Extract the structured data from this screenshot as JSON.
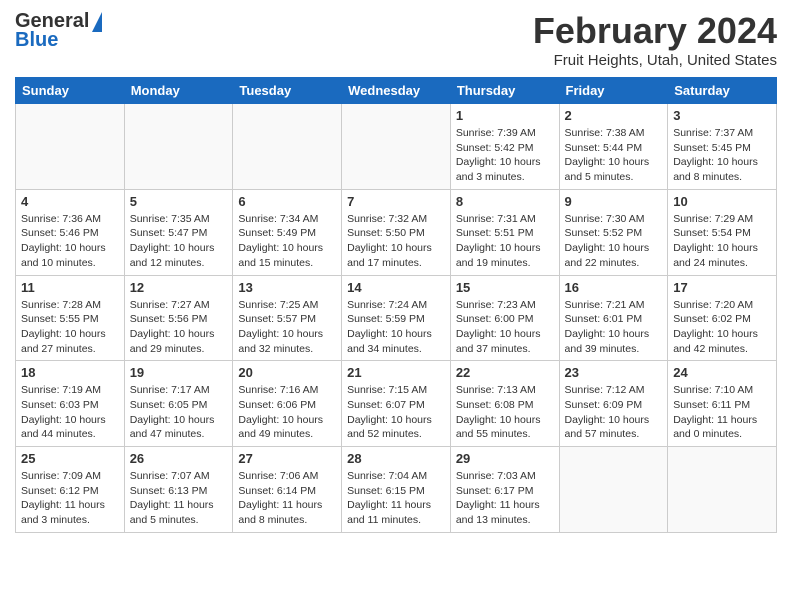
{
  "header": {
    "logo_general": "General",
    "logo_blue": "Blue",
    "month_year": "February 2024",
    "location": "Fruit Heights, Utah, United States"
  },
  "weekdays": [
    "Sunday",
    "Monday",
    "Tuesday",
    "Wednesday",
    "Thursday",
    "Friday",
    "Saturday"
  ],
  "weeks": [
    [
      {
        "day": "",
        "info": ""
      },
      {
        "day": "",
        "info": ""
      },
      {
        "day": "",
        "info": ""
      },
      {
        "day": "",
        "info": ""
      },
      {
        "day": "1",
        "info": "Sunrise: 7:39 AM\nSunset: 5:42 PM\nDaylight: 10 hours\nand 3 minutes."
      },
      {
        "day": "2",
        "info": "Sunrise: 7:38 AM\nSunset: 5:44 PM\nDaylight: 10 hours\nand 5 minutes."
      },
      {
        "day": "3",
        "info": "Sunrise: 7:37 AM\nSunset: 5:45 PM\nDaylight: 10 hours\nand 8 minutes."
      }
    ],
    [
      {
        "day": "4",
        "info": "Sunrise: 7:36 AM\nSunset: 5:46 PM\nDaylight: 10 hours\nand 10 minutes."
      },
      {
        "day": "5",
        "info": "Sunrise: 7:35 AM\nSunset: 5:47 PM\nDaylight: 10 hours\nand 12 minutes."
      },
      {
        "day": "6",
        "info": "Sunrise: 7:34 AM\nSunset: 5:49 PM\nDaylight: 10 hours\nand 15 minutes."
      },
      {
        "day": "7",
        "info": "Sunrise: 7:32 AM\nSunset: 5:50 PM\nDaylight: 10 hours\nand 17 minutes."
      },
      {
        "day": "8",
        "info": "Sunrise: 7:31 AM\nSunset: 5:51 PM\nDaylight: 10 hours\nand 19 minutes."
      },
      {
        "day": "9",
        "info": "Sunrise: 7:30 AM\nSunset: 5:52 PM\nDaylight: 10 hours\nand 22 minutes."
      },
      {
        "day": "10",
        "info": "Sunrise: 7:29 AM\nSunset: 5:54 PM\nDaylight: 10 hours\nand 24 minutes."
      }
    ],
    [
      {
        "day": "11",
        "info": "Sunrise: 7:28 AM\nSunset: 5:55 PM\nDaylight: 10 hours\nand 27 minutes."
      },
      {
        "day": "12",
        "info": "Sunrise: 7:27 AM\nSunset: 5:56 PM\nDaylight: 10 hours\nand 29 minutes."
      },
      {
        "day": "13",
        "info": "Sunrise: 7:25 AM\nSunset: 5:57 PM\nDaylight: 10 hours\nand 32 minutes."
      },
      {
        "day": "14",
        "info": "Sunrise: 7:24 AM\nSunset: 5:59 PM\nDaylight: 10 hours\nand 34 minutes."
      },
      {
        "day": "15",
        "info": "Sunrise: 7:23 AM\nSunset: 6:00 PM\nDaylight: 10 hours\nand 37 minutes."
      },
      {
        "day": "16",
        "info": "Sunrise: 7:21 AM\nSunset: 6:01 PM\nDaylight: 10 hours\nand 39 minutes."
      },
      {
        "day": "17",
        "info": "Sunrise: 7:20 AM\nSunset: 6:02 PM\nDaylight: 10 hours\nand 42 minutes."
      }
    ],
    [
      {
        "day": "18",
        "info": "Sunrise: 7:19 AM\nSunset: 6:03 PM\nDaylight: 10 hours\nand 44 minutes."
      },
      {
        "day": "19",
        "info": "Sunrise: 7:17 AM\nSunset: 6:05 PM\nDaylight: 10 hours\nand 47 minutes."
      },
      {
        "day": "20",
        "info": "Sunrise: 7:16 AM\nSunset: 6:06 PM\nDaylight: 10 hours\nand 49 minutes."
      },
      {
        "day": "21",
        "info": "Sunrise: 7:15 AM\nSunset: 6:07 PM\nDaylight: 10 hours\nand 52 minutes."
      },
      {
        "day": "22",
        "info": "Sunrise: 7:13 AM\nSunset: 6:08 PM\nDaylight: 10 hours\nand 55 minutes."
      },
      {
        "day": "23",
        "info": "Sunrise: 7:12 AM\nSunset: 6:09 PM\nDaylight: 10 hours\nand 57 minutes."
      },
      {
        "day": "24",
        "info": "Sunrise: 7:10 AM\nSunset: 6:11 PM\nDaylight: 11 hours\nand 0 minutes."
      }
    ],
    [
      {
        "day": "25",
        "info": "Sunrise: 7:09 AM\nSunset: 6:12 PM\nDaylight: 11 hours\nand 3 minutes."
      },
      {
        "day": "26",
        "info": "Sunrise: 7:07 AM\nSunset: 6:13 PM\nDaylight: 11 hours\nand 5 minutes."
      },
      {
        "day": "27",
        "info": "Sunrise: 7:06 AM\nSunset: 6:14 PM\nDaylight: 11 hours\nand 8 minutes."
      },
      {
        "day": "28",
        "info": "Sunrise: 7:04 AM\nSunset: 6:15 PM\nDaylight: 11 hours\nand 11 minutes."
      },
      {
        "day": "29",
        "info": "Sunrise: 7:03 AM\nSunset: 6:17 PM\nDaylight: 11 hours\nand 13 minutes."
      },
      {
        "day": "",
        "info": ""
      },
      {
        "day": "",
        "info": ""
      }
    ]
  ]
}
